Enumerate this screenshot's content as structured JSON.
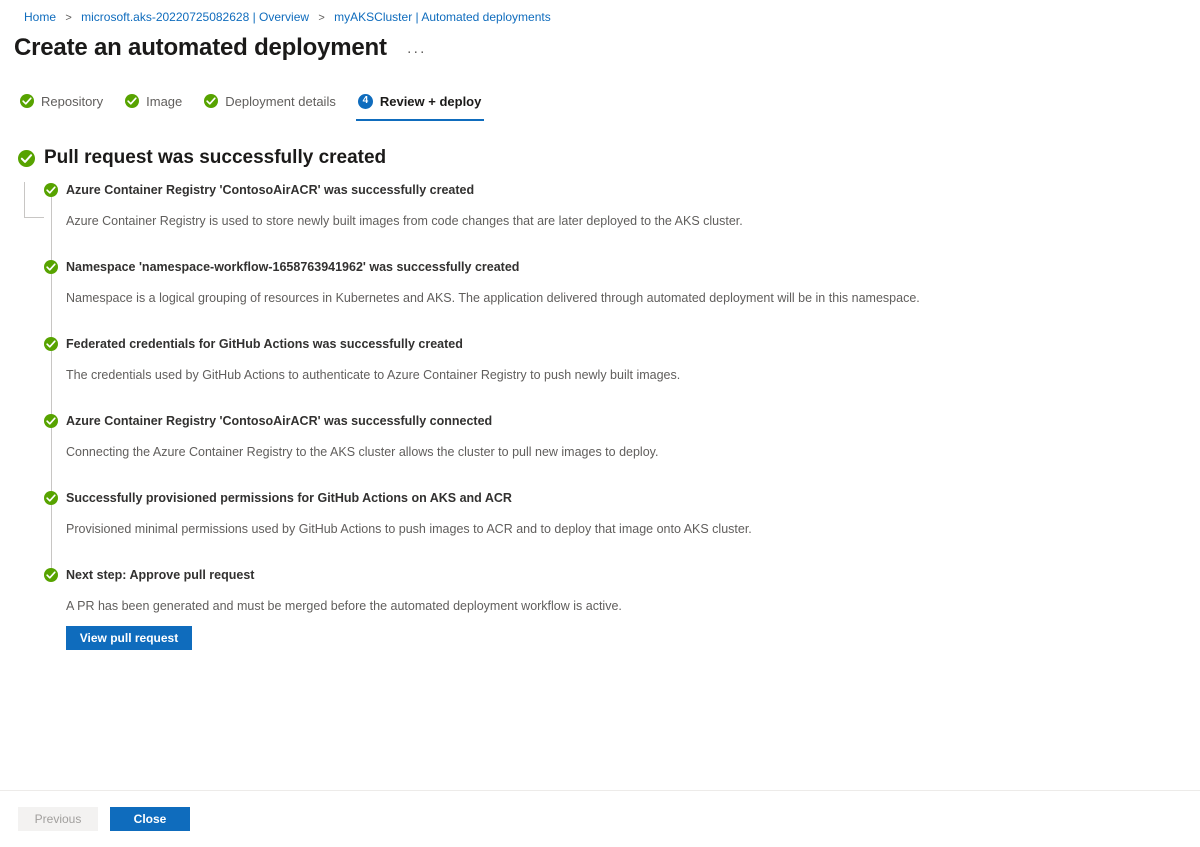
{
  "colors": {
    "accent": "#0f6cbd",
    "success": "#57a300",
    "success_dark": "#498205",
    "text": "#323130",
    "muted": "#605e5c",
    "line": "#c8c6c4"
  },
  "breadcrumb": {
    "items": [
      {
        "label": "Home",
        "link": true
      },
      {
        "label": "microsoft.aks-20220725082628 | Overview",
        "link": true
      },
      {
        "label": "myAKSCluster | Automated deployments",
        "link": true
      }
    ],
    "separator": ">"
  },
  "header": {
    "title": "Create an automated deployment",
    "more_label": "···",
    "more_icon": "ellipsis-icon"
  },
  "tabs": [
    {
      "label": "Repository",
      "state": "complete",
      "icon": "check-circle-icon"
    },
    {
      "label": "Image",
      "state": "complete",
      "icon": "check-circle-icon"
    },
    {
      "label": "Deployment details",
      "state": "complete",
      "icon": "check-circle-icon"
    },
    {
      "label": "Review + deploy",
      "state": "active",
      "number": "4"
    }
  ],
  "result": {
    "icon": "check-circle-icon",
    "heading": "Pull request was successfully created",
    "items": [
      {
        "icon": "check-circle-icon",
        "title": "Azure Container Registry 'ContosoAirACR' was successfully created",
        "description": "Azure Container Registry is used to store newly built images from code changes that are later deployed to the AKS cluster."
      },
      {
        "icon": "check-circle-icon",
        "title": "Namespace 'namespace-workflow-1658763941962' was successfully created",
        "description": "Namespace is a logical grouping of resources in Kubernetes and AKS. The application delivered through automated deployment will be in this namespace."
      },
      {
        "icon": "check-circle-icon",
        "title": "Federated credentials for GitHub Actions was successfully created",
        "description": "The credentials used by GitHub Actions to authenticate to Azure Container Registry to push newly built images."
      },
      {
        "icon": "check-circle-icon",
        "title": "Azure Container Registry 'ContosoAirACR' was successfully connected",
        "description": "Connecting the Azure Container Registry to the AKS cluster allows the cluster to pull new images to deploy."
      },
      {
        "icon": "check-circle-icon",
        "title": "Successfully provisioned permissions for GitHub Actions on AKS and ACR",
        "description": "Provisioned minimal permissions used by GitHub Actions to push images to ACR and to deploy that image onto AKS cluster."
      },
      {
        "icon": "check-circle-icon",
        "title": "Next step: Approve pull request",
        "description": "A PR has been generated and must be merged before the automated deployment workflow is active.",
        "action_label": "View pull request"
      }
    ]
  },
  "footer": {
    "previous_label": "Previous",
    "previous_disabled": true,
    "close_label": "Close"
  }
}
